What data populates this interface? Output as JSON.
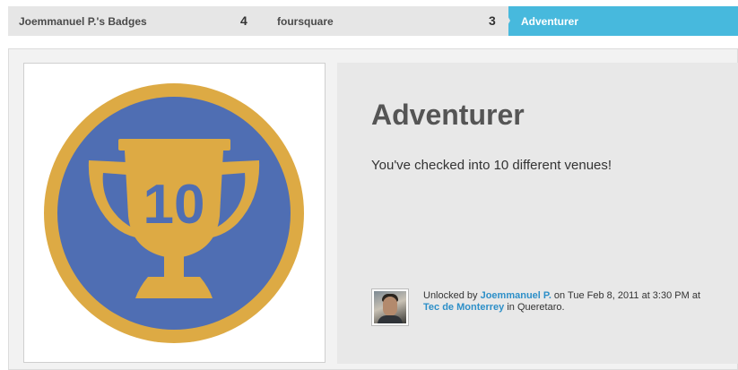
{
  "breadcrumb": {
    "items": [
      {
        "label": "Joemmanuel P.'s Badges",
        "count": "4"
      },
      {
        "label": "foursquare",
        "count": "3"
      },
      {
        "label": "Adventurer"
      }
    ]
  },
  "badge": {
    "icon": "trophy-badge-icon",
    "number": "10",
    "colors": {
      "ring": "#ddaa44",
      "fill": "#4f6eb3"
    }
  },
  "info": {
    "title": "Adventurer",
    "description": "You've checked into 10 different venues!",
    "unlock": {
      "prefix": "Unlocked by ",
      "user": "Joemmanuel P.",
      "middle": " on Tue Feb 8, 2011 at 3:30 PM at ",
      "venue": "Tec de Monterrey",
      "suffix": " in Queretaro."
    }
  },
  "colors": {
    "accent": "#47b9dd",
    "link": "#2d8fc8"
  }
}
